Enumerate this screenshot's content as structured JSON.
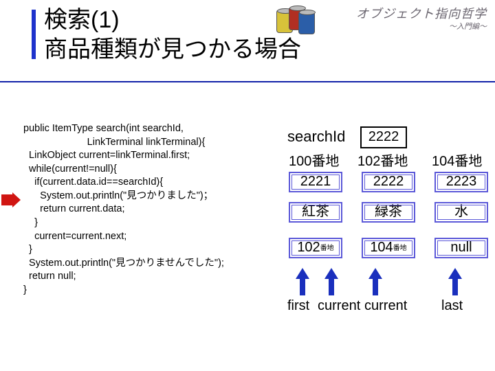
{
  "header": {
    "line1": "オブジェクト指向哲学",
    "line2": "～入門編～"
  },
  "title": {
    "line1": "検索(1)",
    "line2": "商品種類が見つかる場合"
  },
  "code": "public ItemType search(int searchId,\n                       LinkTerminal linkTerminal){\n  LinkObject current=linkTerminal.first;\n  while(current!=null){\n    if(current.data.id==searchId){\n      System.out.println(\"見つかりました\")；\n      return current.data;\n    }\n    current=current.next;\n  }\n  System.out.println(\"見つかりませんでした\");\n  return null;\n}",
  "searchLabel": "searchId",
  "searchValue": "2222",
  "addresses": [
    "100番地",
    "102番地",
    "104番地"
  ],
  "nodes": [
    {
      "id": "2221",
      "name": "紅茶",
      "next": "102",
      "nextSuffix": "番地"
    },
    {
      "id": "2222",
      "name": "緑茶",
      "next": "104",
      "nextSuffix": "番地"
    },
    {
      "id": "2223",
      "name": "水",
      "next": "null",
      "nextSuffix": ""
    }
  ],
  "pointers": {
    "first": "first",
    "current1": "current",
    "current2": "current",
    "last": "last"
  }
}
